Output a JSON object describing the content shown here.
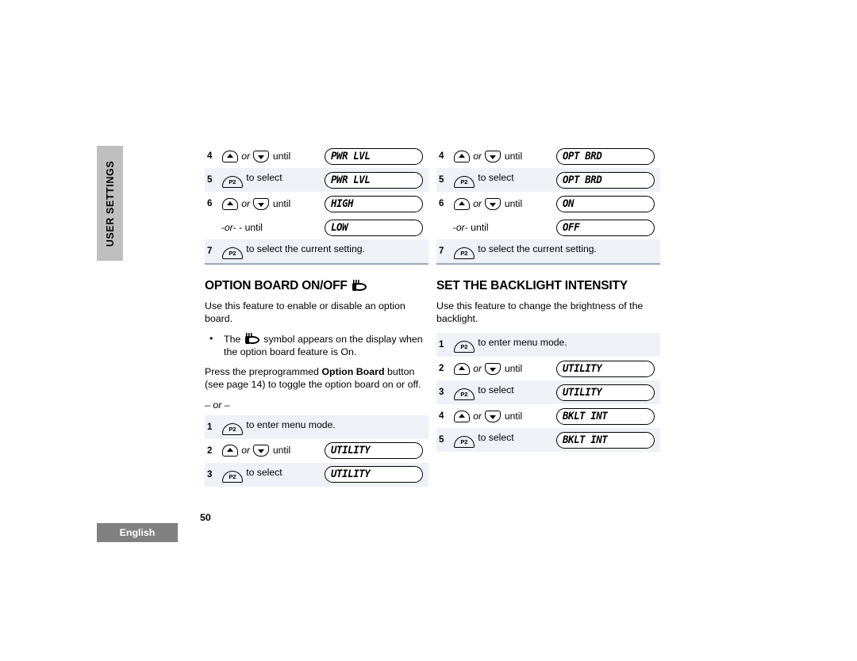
{
  "side_tab": {
    "label": "USER SETTINGS"
  },
  "footer": {
    "language": "English",
    "page_number": "50"
  },
  "icons": {
    "up_key": "up-arrow-key-icon",
    "down_key": "down-arrow-key-icon",
    "p2_key": "p2-button-icon",
    "option_board_symbol": "option-board-symbol-icon"
  },
  "labels": {
    "or": "or",
    "until": "until",
    "or_until": "-or - until",
    "or_until_right": "-or- until",
    "or_separator": "– or –",
    "p2_label": "P2"
  },
  "left_column": {
    "top_table": {
      "rows": [
        {
          "num": "4",
          "action_pre": "",
          "key": "updown",
          "action_post": "until",
          "lcd": "PWR LVL",
          "shaded": false
        },
        {
          "num": "5",
          "action_pre": "",
          "key": "p2",
          "action_post": "to select",
          "lcd": "PWR LVL",
          "shaded": true
        },
        {
          "num": "6",
          "action_pre": "",
          "key": "updown",
          "action_post": "until",
          "lcd": "HIGH",
          "shaded": false
        },
        {
          "num": "",
          "action_pre": "",
          "key": "none",
          "action_post": "-or - until",
          "lcd": "LOW",
          "shaded": false
        },
        {
          "num": "7",
          "action_pre": "",
          "key": "p2",
          "action_post": "to select the current setting.",
          "lcd": "",
          "shaded": true
        }
      ]
    },
    "heading": "OPTION BOARD ON/OFF",
    "heading_has_symbol": true,
    "intro": "Use this feature to enable or disable an option board.",
    "bullet_pre": "The",
    "bullet_post": "symbol appears on the display when the option board feature is On.",
    "press_text_1": "Press the preprogrammed ",
    "press_bold": "Option Board",
    "press_text_2": " button (see page 14) to toggle the option board on or off.",
    "bottom_table": {
      "rows": [
        {
          "num": "1",
          "key": "p2",
          "action_post": "to enter menu mode.",
          "lcd": "",
          "shaded": true
        },
        {
          "num": "2",
          "key": "updown",
          "action_post": "until",
          "lcd": "UTILITY",
          "shaded": false
        },
        {
          "num": "3",
          "key": "p2",
          "action_post": "to select",
          "lcd": "UTILITY",
          "shaded": true
        }
      ]
    }
  },
  "right_column": {
    "top_table": {
      "rows": [
        {
          "num": "4",
          "key": "updown",
          "action_post": "until",
          "lcd": "OPT BRD",
          "shaded": false
        },
        {
          "num": "5",
          "key": "p2",
          "action_post": "to select",
          "lcd": "OPT BRD",
          "shaded": true
        },
        {
          "num": "6",
          "key": "updown",
          "action_post": "until",
          "lcd": "ON",
          "shaded": false
        },
        {
          "num": "",
          "key": "none",
          "action_post": "-or- until",
          "lcd": "OFF",
          "shaded": false
        },
        {
          "num": "7",
          "key": "p2",
          "action_post": "to select the current setting.",
          "lcd": "",
          "shaded": true
        }
      ]
    },
    "heading": "SET THE BACKLIGHT INTENSITY",
    "intro": "Use this feature to change the brightness of the backlight.",
    "bottom_table": {
      "rows": [
        {
          "num": "1",
          "key": "p2",
          "action_post": "to enter menu mode.",
          "lcd": "",
          "shaded": true
        },
        {
          "num": "2",
          "key": "updown",
          "action_post": "until",
          "lcd": "UTILITY",
          "shaded": false
        },
        {
          "num": "3",
          "key": "p2",
          "action_post": "to select",
          "lcd": "UTILITY",
          "shaded": true
        },
        {
          "num": "4",
          "key": "updown",
          "action_post": "until",
          "lcd": "BKLT INT",
          "shaded": false
        },
        {
          "num": "5",
          "key": "p2",
          "action_post": "to select",
          "lcd": "BKLT INT",
          "shaded": true
        }
      ]
    }
  },
  "colors": {
    "side_tab_bg": "#bfbfbf",
    "lang_tab_bg": "#808080",
    "row_shade": "#eef1f6",
    "rule": "#9aa8bb"
  }
}
